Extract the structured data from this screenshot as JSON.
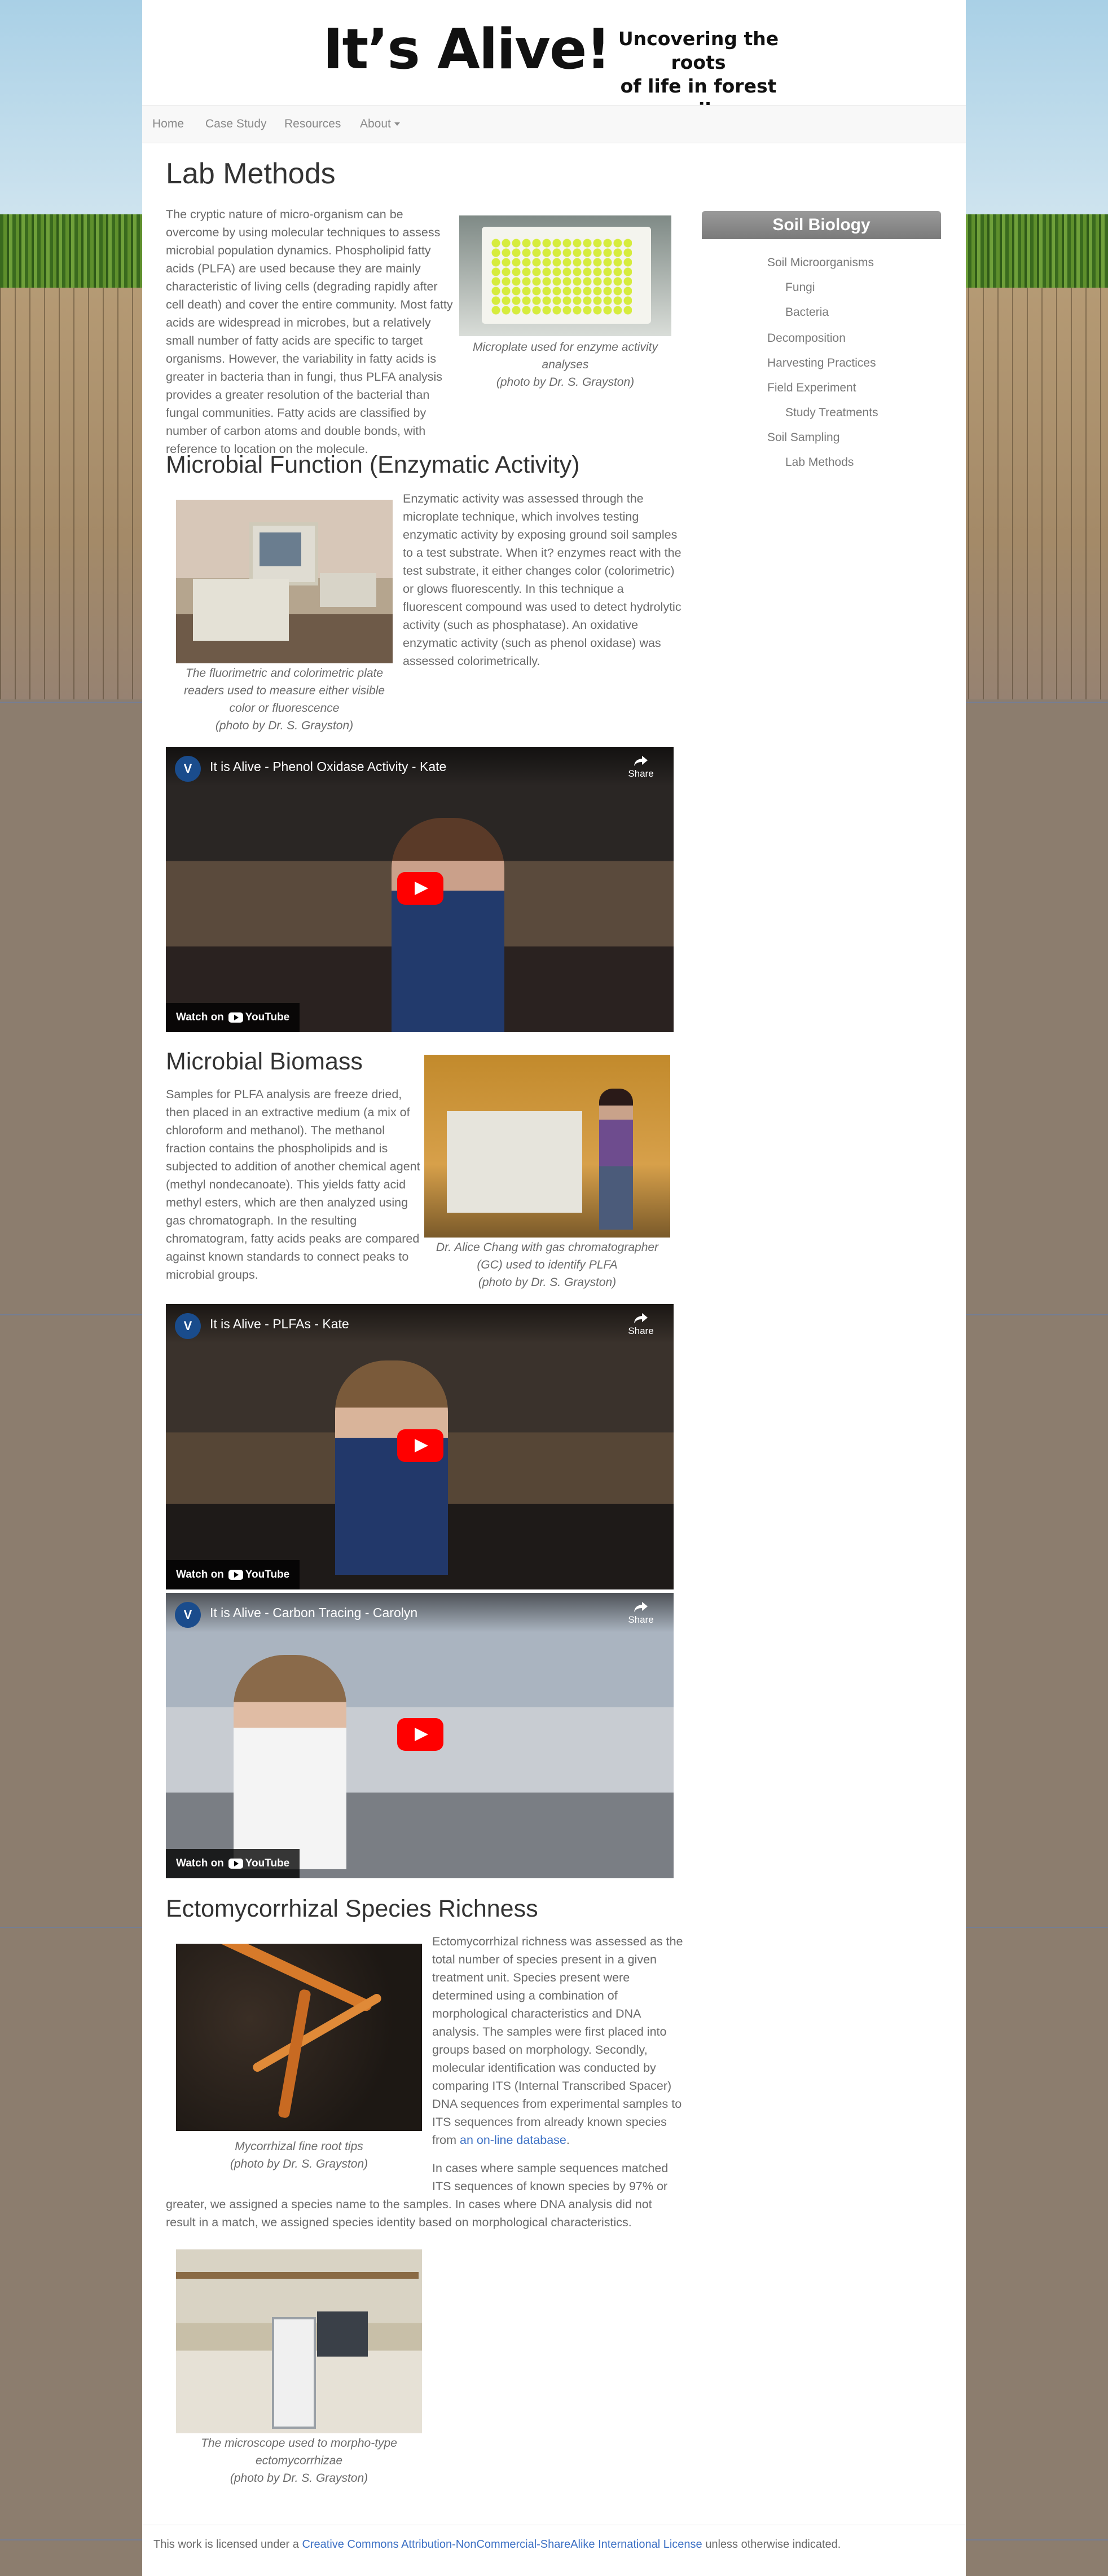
{
  "header": {
    "logo_main": "It’s Alive!",
    "tagline_line1": "Uncovering the roots",
    "tagline_line2": "of life in forest soils"
  },
  "nav": {
    "home": "Home",
    "case_study": "Case Study",
    "resources": "Resources",
    "about": "About"
  },
  "page_title": "Lab Methods",
  "intro": {
    "text": "The cryptic nature of micro-organism can be overcome by using molecular techniques to assess microbial population dynamics. Phospholipid fatty acids (PLFA) are used because they are mainly characteristic of living cells (degrading rapidly after cell death) and cover the entire community. Most fatty acids are widespread in microbes, but a relatively small number of fatty acids are specific to target organisms. However, the variability in fatty acids is greater in bacteria than in fungi, thus PLFA analysis provides a greater resolution of the bacterial than fungal communities. Fatty acids are classified by number of carbon atoms and double bonds, with reference to location on the molecule.",
    "caption_line1": "Microplate used for enzyme activity",
    "caption_line2": "analyses",
    "caption_line3": "(photo by Dr. S. Grayston)"
  },
  "microbial_function": {
    "title": "Microbial Function (Enzymatic Activity)",
    "text": "Enzymatic activity was assessed through the microplate technique, which involves testing enzymatic activity by exposing ground soil samples to a test substrate. When it? enzymes react with the test substrate, it either changes color (colorimetric) or glows fluorescently.  In this technique a fluorescent compound was used to detect hydrolytic activity (such as phosphatase). An oxidative enzymatic activity (such as phenol oxidase) was assessed colorimetrically.",
    "caption_line1": "The fluorimetric and colorimetric plate",
    "caption_line2": "readers used to measure either visible",
    "caption_line3": "color or fluorescence",
    "caption_line4": "(photo by Dr. S. Grayston)"
  },
  "videos": {
    "v1_title": "It is Alive - Phenol Oxidase Activity - Kate",
    "v2_title": "It is Alive - PLFAs - Kate",
    "v3_title": "It is Alive - Carbon Tracing - Carolyn",
    "share_label": "Share",
    "watch_on": "Watch on",
    "youtube": "YouTube",
    "avatar_letter": "V"
  },
  "microbial_biomass": {
    "title": "Microbial Biomass",
    "text": "Samples for PLFA analysis are freeze dried, then placed in an extractive medium (a mix of chloroform and methanol). The methanol fraction contains the phospholipids and is subjected to addition of another chemical agent (methyl nondecanoate). This yields fatty acid methyl esters, which are then analyzed using gas chromatograph. In the resulting chromatogram, fatty acids peaks are compared against known standards to connect peaks to microbial groups.",
    "caption_line1": "Dr. Alice Chang with gas chromatographer",
    "caption_line2": "(GC) used to identify PLFA",
    "caption_line3": "(photo by Dr. S. Grayston)"
  },
  "ecto": {
    "title": "Ectomycorrhizal Species Richness",
    "text1_pre": "Ectomycorrhizal richness was assessed as the total number of species present in a given treatment unit. Species present were determined using a combination of morphological characteristics and DNA analysis. The samples were first placed into groups based on morphology. Secondly, molecular identification was conducted by comparing ITS (Internal Transcribed Spacer) DNA sequences from experimental samples to ITS sequences from already known species from ",
    "text1_link": "an on-line database",
    "text1_post": ".",
    "text2_a": "In cases where sample sequences matched ITS sequences of known species by 97% or",
    "text2_b": "greater, we assigned a species name to the samples.  In cases where DNA analysis did not result in a match, we assigned species identity based on morphological characteristics.",
    "caption1_line1": "Mycorrhizal fine root tips",
    "caption1_line2": "(photo by Dr. S. Grayston)",
    "caption2_line1": "The microscope used to morpho-type",
    "caption2_line2": "ectomycorrhizae",
    "caption2_line3": "(photo by Dr. S. Grayston)"
  },
  "sidebar": {
    "heading": "Soil Biology",
    "items": [
      {
        "label": "Soil Microorganisms"
      },
      {
        "label": "Fungi"
      },
      {
        "label": "Bacteria"
      },
      {
        "label": "Decomposition"
      },
      {
        "label": "Harvesting Practices"
      },
      {
        "label": "Field Experiment"
      },
      {
        "label": "Study Treatments"
      },
      {
        "label": "Soil Sampling"
      },
      {
        "label": "Lab Methods"
      }
    ]
  },
  "footer": {
    "pre": "This work is licensed under a ",
    "link": "Creative Commons Attribution-NonCommercial-ShareAlike International License",
    "post": " unless otherwise indicated."
  },
  "colors": {
    "link": "#3b6fc4",
    "youtube_red": "#ff0000",
    "sidebar_header": "#8a8a8a",
    "microplate_wells": "#d6ec3d"
  }
}
